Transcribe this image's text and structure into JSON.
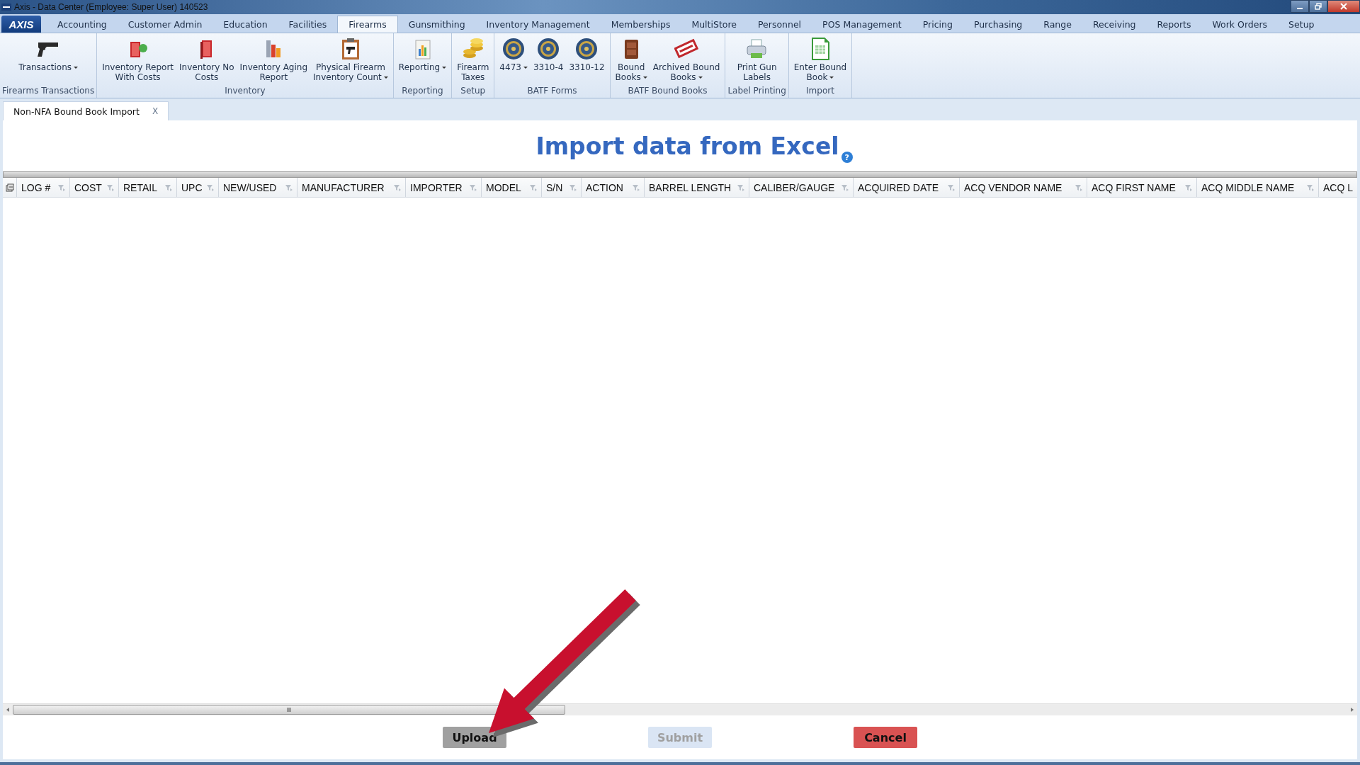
{
  "window": {
    "title": "Axis - Data Center  (Employee: Super User) 140523"
  },
  "app_button": {
    "label": "AXIS"
  },
  "menu_tabs": [
    {
      "label": "Accounting",
      "selected": false
    },
    {
      "label": "Customer Admin",
      "selected": false
    },
    {
      "label": "Education",
      "selected": false
    },
    {
      "label": "Facilities",
      "selected": false
    },
    {
      "label": "Firearms",
      "selected": true
    },
    {
      "label": "Gunsmithing",
      "selected": false
    },
    {
      "label": "Inventory Management",
      "selected": false
    },
    {
      "label": "Memberships",
      "selected": false
    },
    {
      "label": "MultiStore",
      "selected": false
    },
    {
      "label": "Personnel",
      "selected": false
    },
    {
      "label": "POS Management",
      "selected": false
    },
    {
      "label": "Pricing",
      "selected": false
    },
    {
      "label": "Purchasing",
      "selected": false
    },
    {
      "label": "Range",
      "selected": false
    },
    {
      "label": "Receiving",
      "selected": false
    },
    {
      "label": "Reports",
      "selected": false
    },
    {
      "label": "Work Orders",
      "selected": false
    },
    {
      "label": "Setup",
      "selected": false
    }
  ],
  "ribbon": [
    {
      "label": "Firearms Transactions",
      "items": [
        {
          "label": "Transactions",
          "dropdown": true
        }
      ]
    },
    {
      "label": "Inventory",
      "items": [
        {
          "label": "Inventory Report\nWith Costs",
          "dropdown": false
        },
        {
          "label": "Inventory No\nCosts",
          "dropdown": false
        },
        {
          "label": "Inventory Aging\nReport",
          "dropdown": false
        },
        {
          "label": "Physical Firearm\nInventory Count",
          "dropdown": true
        }
      ]
    },
    {
      "label": "Reporting",
      "items": [
        {
          "label": "Reporting",
          "dropdown": true
        }
      ]
    },
    {
      "label": "Setup",
      "items": [
        {
          "label": "Firearm\nTaxes",
          "dropdown": false
        }
      ]
    },
    {
      "label": "BATF Forms",
      "items": [
        {
          "label": "4473",
          "dropdown": true
        },
        {
          "label": "3310-4",
          "dropdown": false
        },
        {
          "label": "3310-12",
          "dropdown": false
        }
      ]
    },
    {
      "label": "BATF Bound Books",
      "items": [
        {
          "label": "Bound\nBooks",
          "dropdown": true
        },
        {
          "label": "Archived Bound\nBooks",
          "dropdown": true
        }
      ]
    },
    {
      "label": "Label Printing",
      "items": [
        {
          "label": "Print Gun\nLabels",
          "dropdown": false
        }
      ]
    },
    {
      "label": "Import",
      "items": [
        {
          "label": "Enter Bound\nBook",
          "dropdown": true
        }
      ]
    }
  ],
  "document_tab": {
    "label": "Non-NFA Bound Book Import",
    "close": "X"
  },
  "heading": {
    "title": "Import data from Excel",
    "help": "?"
  },
  "table": {
    "columns": [
      "LOG #",
      "COST",
      "RETAIL",
      "UPC",
      "NEW/USED",
      "MANUFACTURER",
      "IMPORTER",
      "MODEL",
      "S/N",
      "ACTION",
      "BARREL LENGTH",
      "CALIBER/GAUGE",
      "ACQUIRED DATE",
      "ACQ VENDOR NAME",
      "ACQ FIRST NAME",
      "ACQ MIDDLE NAME",
      "ACQ L"
    ]
  },
  "buttons": [
    {
      "label": "Upload",
      "kind": "neutral",
      "disabled": false
    },
    {
      "label": "Submit",
      "kind": "primary",
      "disabled": true
    },
    {
      "label": "Cancel",
      "kind": "danger",
      "disabled": false
    }
  ]
}
